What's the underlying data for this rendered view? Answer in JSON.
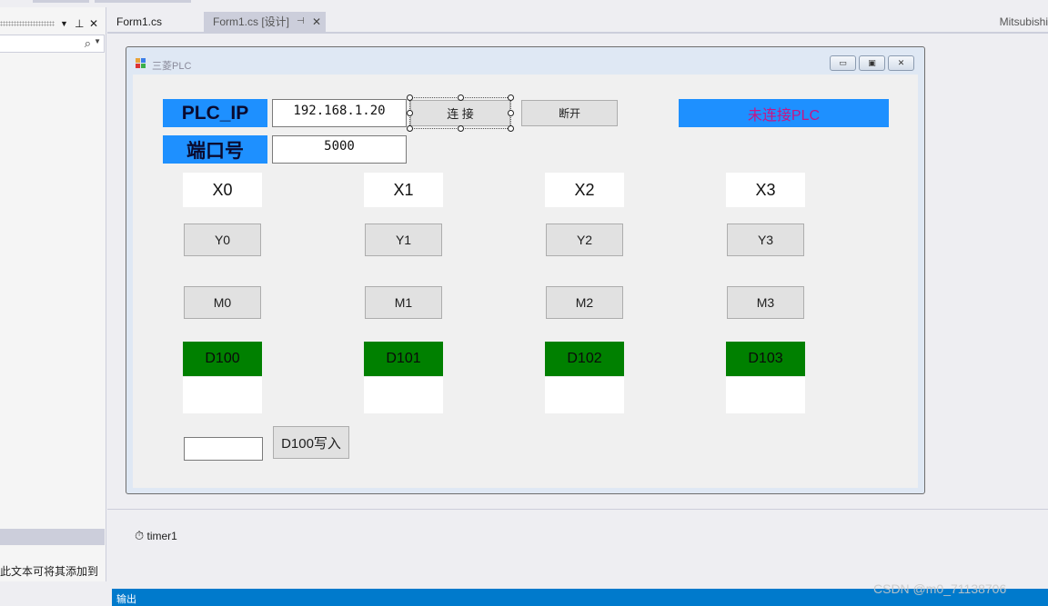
{
  "left_panel": {
    "search_icon": "search-icon",
    "partial_text": "此文本可将其添加到"
  },
  "tabs": {
    "file_tab": "Form1.cs",
    "design_tab": "Form1.cs [设计]",
    "design_close": "✕",
    "right_text": "Mitsubishi"
  },
  "form": {
    "title": "三菱PLC",
    "labels": {
      "plc_ip": "PLC_IP",
      "port": "端口号"
    },
    "ip_value": "192.168.1.20",
    "port_value": "5000",
    "connect_label": "连 接",
    "disconnect_label": "断开",
    "status_text": "未连接PLC",
    "x_labels": [
      "X0",
      "X1",
      "X2",
      "X3"
    ],
    "y_buttons": [
      "Y0",
      "Y1",
      "Y2",
      "Y3"
    ],
    "m_buttons": [
      "M0",
      "M1",
      "M2",
      "M3"
    ],
    "d_labels": [
      "D100",
      "D101",
      "D102",
      "D103"
    ],
    "write_button": "D100写入",
    "write_value": ""
  },
  "tray": {
    "timer": "timer1"
  },
  "output": {
    "label": "输出"
  },
  "watermark": "CSDN @m0_71138706",
  "colors": {
    "status_blue": "#1e90ff",
    "d_green": "#008000",
    "status_text": "#c71585",
    "output_bar": "#007acc"
  }
}
